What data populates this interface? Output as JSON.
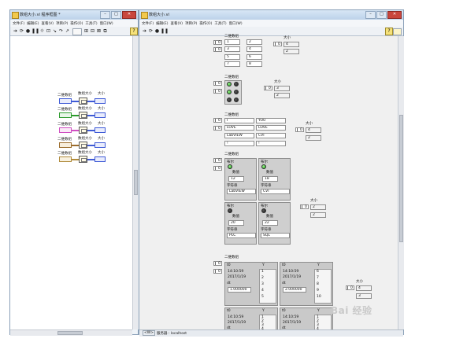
{
  "diagram_window": {
    "title": "数组大小.vi 程序框图 *",
    "menus": [
      "文件(F)",
      "编辑(E)",
      "查看(V)",
      "项目(P)",
      "操作(O)",
      "工具(T)",
      "窗口(W)"
    ],
    "rows": [
      {
        "in_label": "二维数组",
        "fn_label": "数组大小",
        "out_label": "大小",
        "in_type": "I32",
        "wire_color": "#3f5bd6",
        "term_color": "#3f5bd6",
        "out_type": "I32"
      },
      {
        "in_label": "二维数组",
        "fn_label": "数组大小",
        "out_label": "大小",
        "in_type": "[TF]",
        "wire_color": "#2d9b2d",
        "term_color": "#2d9b2d",
        "out_type": "I32"
      },
      {
        "in_label": "二维数组",
        "fn_label": "数组大小",
        "out_label": "大小",
        "in_type": "abc",
        "wire_color": "#d04fc2",
        "term_color": "#d04fc2",
        "out_type": "I32"
      },
      {
        "in_label": "二维数组",
        "fn_label": "数组大小",
        "out_label": "大小",
        "in_type": "[*]",
        "wire_color": "#9b6c2c",
        "term_color": "#9b6c2c",
        "out_type": "I32"
      },
      {
        "in_label": "二维数组",
        "fn_label": "数组大小",
        "out_label": "大小",
        "in_type": "[W]",
        "wire_color": "#b08b3c",
        "term_color": "#b08b3c",
        "out_type": "I32"
      }
    ]
  },
  "panel_window": {
    "title": "数组大小.vi",
    "menus": [
      "文件(F)",
      "编辑(E)",
      "查看(V)",
      "项目(P)",
      "操作(O)",
      "工具(T)",
      "窗口(W)"
    ],
    "status": {
      "target": "<W>",
      "server": "服务器 : localhost"
    },
    "index_zero": "0",
    "size_label": "大小",
    "array_label": "二维数组",
    "numeric_array": {
      "values": [
        "1",
        "2",
        "3",
        "4",
        "5",
        "6",
        "7",
        "8"
      ],
      "size": [
        "4",
        "2"
      ]
    },
    "bool_array": {
      "leds": [
        "on",
        "off",
        "on",
        "off",
        "off",
        "off"
      ],
      "size": [
        "3",
        "2"
      ]
    },
    "string_array": {
      "values": [
        "I",
        "YOU",
        "LOVE",
        "LOVE",
        "LabVIEW",
        "CVI",
        "!",
        "!"
      ],
      "size": [
        "4",
        "2"
      ]
    },
    "cluster_array": {
      "bool_label": "布尔",
      "num_label": "数值",
      "str_label": "字符串",
      "items": [
        {
          "led": "on",
          "num": "12",
          "str": "LabVIEW"
        },
        {
          "led": "on",
          "num": "18",
          "str": "CVI"
        },
        {
          "led": "off",
          "num": "20",
          "str": "PLC"
        },
        {
          "led": "off",
          "num": "22",
          "str": "SQL"
        }
      ],
      "size": [
        "2",
        "2"
      ]
    },
    "waveform_array": {
      "t0_label": "t0",
      "dt_label": "dt",
      "y_label": "Y",
      "items": [
        {
          "time": "14:10:59",
          "date": "2017/1/19",
          "dt": "1.000000",
          "y": [
            "1",
            "2",
            "3",
            "4",
            "5"
          ]
        },
        {
          "time": "14:10:59",
          "date": "2017/1/19",
          "dt": "2.000000",
          "y": [
            "6",
            "7",
            "8",
            "9",
            "10"
          ]
        },
        {
          "time": "14:10:59",
          "date": "2017/1/19",
          "dt": "",
          "y": [
            "1",
            "2",
            "3",
            "4",
            ""
          ]
        },
        {
          "time": "14:10:59",
          "date": "2017/1/19",
          "dt": "",
          "y": [
            "1",
            "2",
            "3",
            "4",
            ""
          ]
        }
      ],
      "size": [
        "4",
        "3"
      ]
    }
  },
  "watermark": "Bai 经验"
}
